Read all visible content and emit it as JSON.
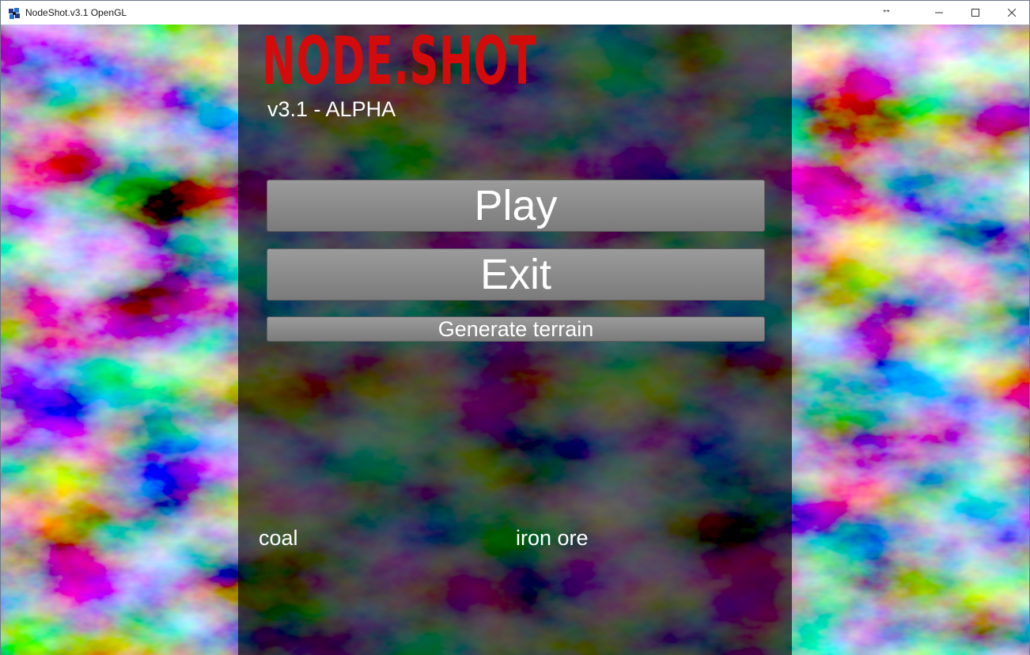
{
  "window": {
    "title": "NodeShot.v3.1 OpenGL",
    "resize_indicator": "↔"
  },
  "logo": {
    "text": "NODE.SHOT",
    "color": "#d40b0b"
  },
  "version": "v3.1 - ALPHA",
  "menu": {
    "play_label": "Play",
    "exit_label": "Exit",
    "generate_terrain_label": "Generate terrain"
  },
  "resources": {
    "first": "coal",
    "second": "iron ore"
  },
  "icons": {
    "app": "app-icon",
    "minimize": "minimize-icon",
    "maximize": "maximize-icon",
    "close": "close-icon"
  }
}
